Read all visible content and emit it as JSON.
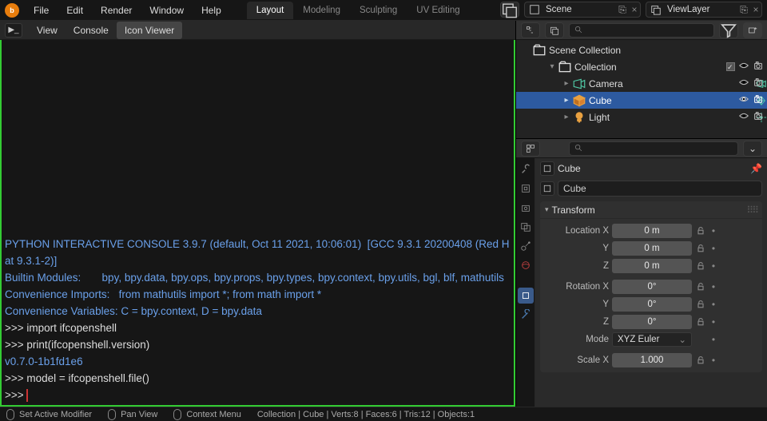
{
  "topmenu": {
    "items": [
      "File",
      "Edit",
      "Render",
      "Window",
      "Help"
    ]
  },
  "workspaces": {
    "tabs": [
      "Layout",
      "Modeling",
      "Sculpting",
      "UV Editing"
    ],
    "active": 0
  },
  "scene_picker": {
    "scene": "Scene",
    "layer": "ViewLayer"
  },
  "console_header": {
    "tabs": [
      "View",
      "Console",
      "Icon Viewer"
    ],
    "active": 2
  },
  "console": {
    "lines": [
      {
        "t": "",
        "cls": "output"
      },
      {
        "t": "PYTHON INTERACTIVE CONSOLE 3.9.7 (default, Oct 11 2021, 10:06:01)  [GCC 9.3.1 20200408 (Red Hat 9.3.1-2)]",
        "cls": "output"
      },
      {
        "t": "",
        "cls": "output"
      },
      {
        "t": "Builtin Modules:       bpy, bpy.data, bpy.ops, bpy.props, bpy.types, bpy.context, bpy.utils, bgl, blf, mathutils",
        "cls": "output"
      },
      {
        "t": "Convenience Imports:   from mathutils import *; from math import *",
        "cls": "output"
      },
      {
        "t": "Convenience Variables: C = bpy.context, D = bpy.data",
        "cls": "output"
      },
      {
        "t": "",
        "cls": "output"
      },
      {
        "t": ">>> import ifcopenshell",
        "cls": "prompt"
      },
      {
        "t": ">>> print(ifcopenshell.version)",
        "cls": "prompt"
      },
      {
        "t": "v0.7.0-1b1fd1e6",
        "cls": "output"
      },
      {
        "t": "",
        "cls": "output"
      },
      {
        "t": ">>> model = ifcopenshell.file()",
        "cls": "prompt"
      },
      {
        "t": ">>> ",
        "cls": "prompt",
        "cursor": true
      }
    ]
  },
  "outliner": {
    "scene_collection": "Scene Collection",
    "collection": "Collection",
    "items": [
      {
        "name": "Camera",
        "kind": "camera"
      },
      {
        "name": "Cube",
        "kind": "mesh",
        "selected": true
      },
      {
        "name": "Light",
        "kind": "light"
      }
    ]
  },
  "properties": {
    "object": "Cube",
    "name_field": "Cube",
    "transform_label": "Transform",
    "location": {
      "label": "Location",
      "x": "0 m",
      "y": "0 m",
      "z": "0 m"
    },
    "rotation": {
      "label": "Rotation",
      "x": "0°",
      "y": "0°",
      "z": "0°"
    },
    "mode": {
      "label": "Mode",
      "value": "XYZ Euler"
    },
    "scale": {
      "label": "Scale",
      "x": "1.000"
    }
  },
  "statusbar": {
    "left": [
      "Set Active Modifier",
      "Pan View",
      "Context Menu"
    ],
    "right": "Collection | Cube | Verts:8 | Faces:6 | Tris:12 | Objects:1"
  }
}
